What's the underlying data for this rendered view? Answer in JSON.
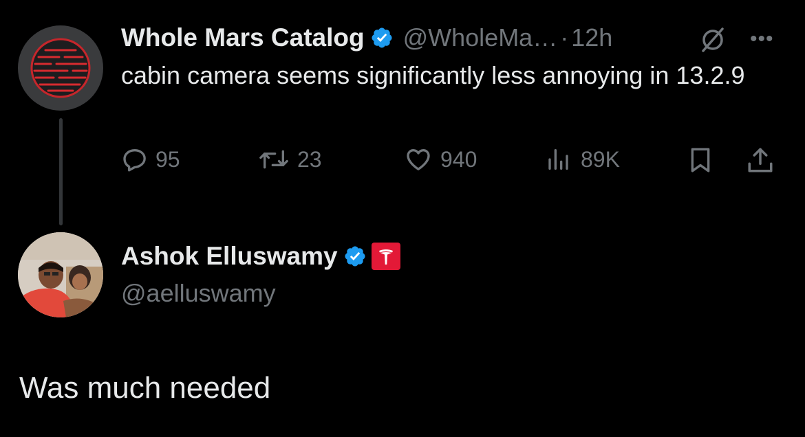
{
  "original_tweet": {
    "author_name": "Whole Mars Catalog",
    "handle": "@WholeMa…",
    "separator": "·",
    "time": "12h",
    "text": "cabin camera seems significantly less annoying in 13.2.9",
    "verified_color": "#1d9bf0",
    "avatar_icon": "mars-planet-icon",
    "accent_color": "#e0332f"
  },
  "actions": {
    "replies": "95",
    "reposts": "23",
    "likes": "940",
    "views": "89K"
  },
  "reply_tweet": {
    "author_name": "Ashok Elluswamy",
    "handle": "@aelluswamy",
    "text": "Was much needed",
    "affiliation_icon": "tesla-logo-icon",
    "affiliation_color": "#e31937"
  }
}
